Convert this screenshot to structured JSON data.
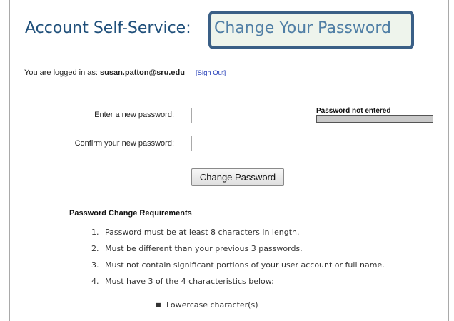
{
  "page": {
    "title": "Account Self-Service:",
    "title_highlight": "Change Your Password"
  },
  "login": {
    "prefix": "You are logged in as:",
    "username": "susan.patton@sru.edu",
    "sign_out": "[Sign Out]"
  },
  "form": {
    "new_password_label": "Enter a new password:",
    "new_password_value": "",
    "confirm_password_label": "Confirm your new password:",
    "confirm_password_value": "",
    "strength_text": "Password not entered",
    "strength_level": 0,
    "submit_label": "Change Password"
  },
  "requirements": {
    "title": "Password Change Requirements",
    "items": [
      {
        "num": "1.",
        "text": "Password must be at least 8 characters in length."
      },
      {
        "num": "2.",
        "text": "Must be different than your previous 3 passwords."
      },
      {
        "num": "3.",
        "text": "Must not contain significant portions of your user account or full name."
      },
      {
        "num": "4.",
        "text": "Must have 3 of the 4 characteristics below:"
      }
    ],
    "characteristics": [
      "Lowercase character(s)"
    ]
  },
  "colors": {
    "title": "#1f4f7a",
    "highlight_border": "#3a5f86",
    "highlight_text": "#4f7ea5",
    "link": "#1a35b5"
  }
}
